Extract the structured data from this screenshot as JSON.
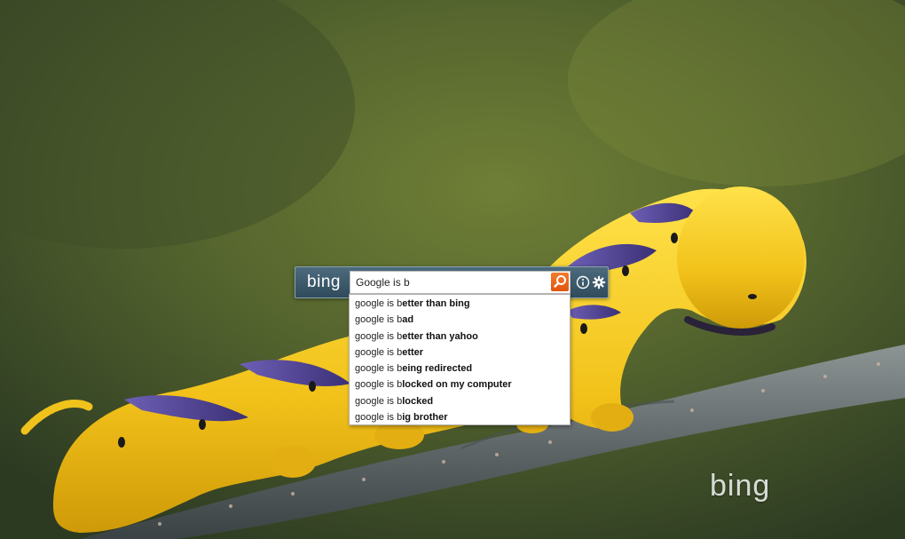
{
  "brand": {
    "logo_text": "bing",
    "watermark_text": "bing"
  },
  "search": {
    "query": "Google is b",
    "search_icon": "magnifier-icon",
    "info_icon": "info-icon",
    "settings_icon": "gear-icon",
    "accent_color": "#e8621a"
  },
  "suggestions": [
    {
      "prefix": "google is b",
      "completion": "etter than bing"
    },
    {
      "prefix": "google is b",
      "completion": "ad"
    },
    {
      "prefix": "google is b",
      "completion": "etter than yahoo"
    },
    {
      "prefix": "google is b",
      "completion": "etter"
    },
    {
      "prefix": "google is b",
      "completion": "eing redirected"
    },
    {
      "prefix": "google is b",
      "completion": "locked on my computer"
    },
    {
      "prefix": "google is b",
      "completion": "locked"
    },
    {
      "prefix": "google is b",
      "completion": "ig brother"
    }
  ],
  "background": {
    "subject": "yellow-caterpillar-on-branch-photo"
  }
}
